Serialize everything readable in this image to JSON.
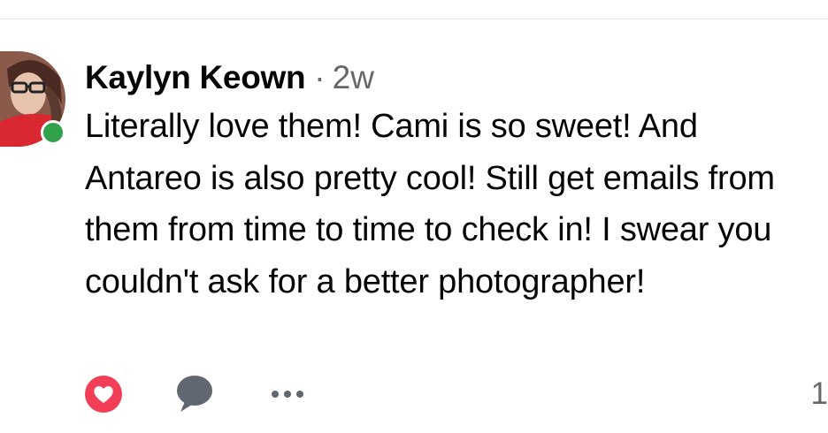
{
  "comment": {
    "author": "Kaylyn Keown",
    "separator": "·",
    "time": "2w",
    "text": "Literally love them! Cami is so sweet! And Antareo is also pretty cool! Still get emails from them from time to time to check in! I swear you couldn't ask for a better photographer!",
    "online": true
  },
  "actions": {
    "love_icon": "love-reaction-icon",
    "comment_icon": "comment-bubble-icon",
    "more_icon": "more-options-icon",
    "count": "1"
  },
  "colors": {
    "online_dot": "#31a24c",
    "love": "#f33e58",
    "secondary_text": "#65676b",
    "icon_gray": "#606770"
  }
}
